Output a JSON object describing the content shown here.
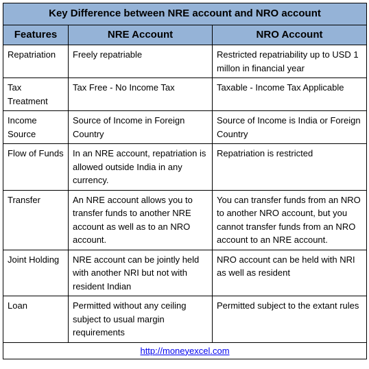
{
  "title": "Key Difference between NRE account and NRO account",
  "headers": {
    "features": "Features",
    "nre": "NRE Account",
    "nro": "NRO Account"
  },
  "rows": [
    {
      "feature": "Repatriation",
      "nre": "Freely repatriable",
      "nro": "Restricted repatriability up to USD 1 millon in financial year"
    },
    {
      "feature": "Tax Treatment",
      "nre": "Tax Free - No Income Tax",
      "nro": "Taxable - Income Tax Applicable"
    },
    {
      "feature": "Income Source",
      "nre": "Source of Income in Foreign Country",
      "nro": "Source of Income is India or Foreign Country"
    },
    {
      "feature": "Flow of Funds",
      "nre": "In an NRE account, repatriation is allowed outside India in any currency.",
      "nro": "Repatriation is restricted"
    },
    {
      "feature": "Transfer",
      "nre": "An NRE account allows you to transfer funds to another NRE account as well as to an NRO account.",
      "nro": "You can transfer funds from an NRO to another NRO account, but you cannot transfer funds from an NRO account to an NRE account."
    },
    {
      "feature": "Joint Holding",
      "nre": "NRE account can be jointly held with another NRI but not with resident Indian",
      "nro": "NRO account can be held with NRI as well as resident"
    },
    {
      "feature": "Loan",
      "nre": "Permitted without any ceiling subject to usual margin requirements",
      "nro": "Permitted subject to the extant rules"
    }
  ],
  "footer": {
    "link_text": "http://moneyexcel.com",
    "link_href": "http://moneyexcel.com"
  }
}
